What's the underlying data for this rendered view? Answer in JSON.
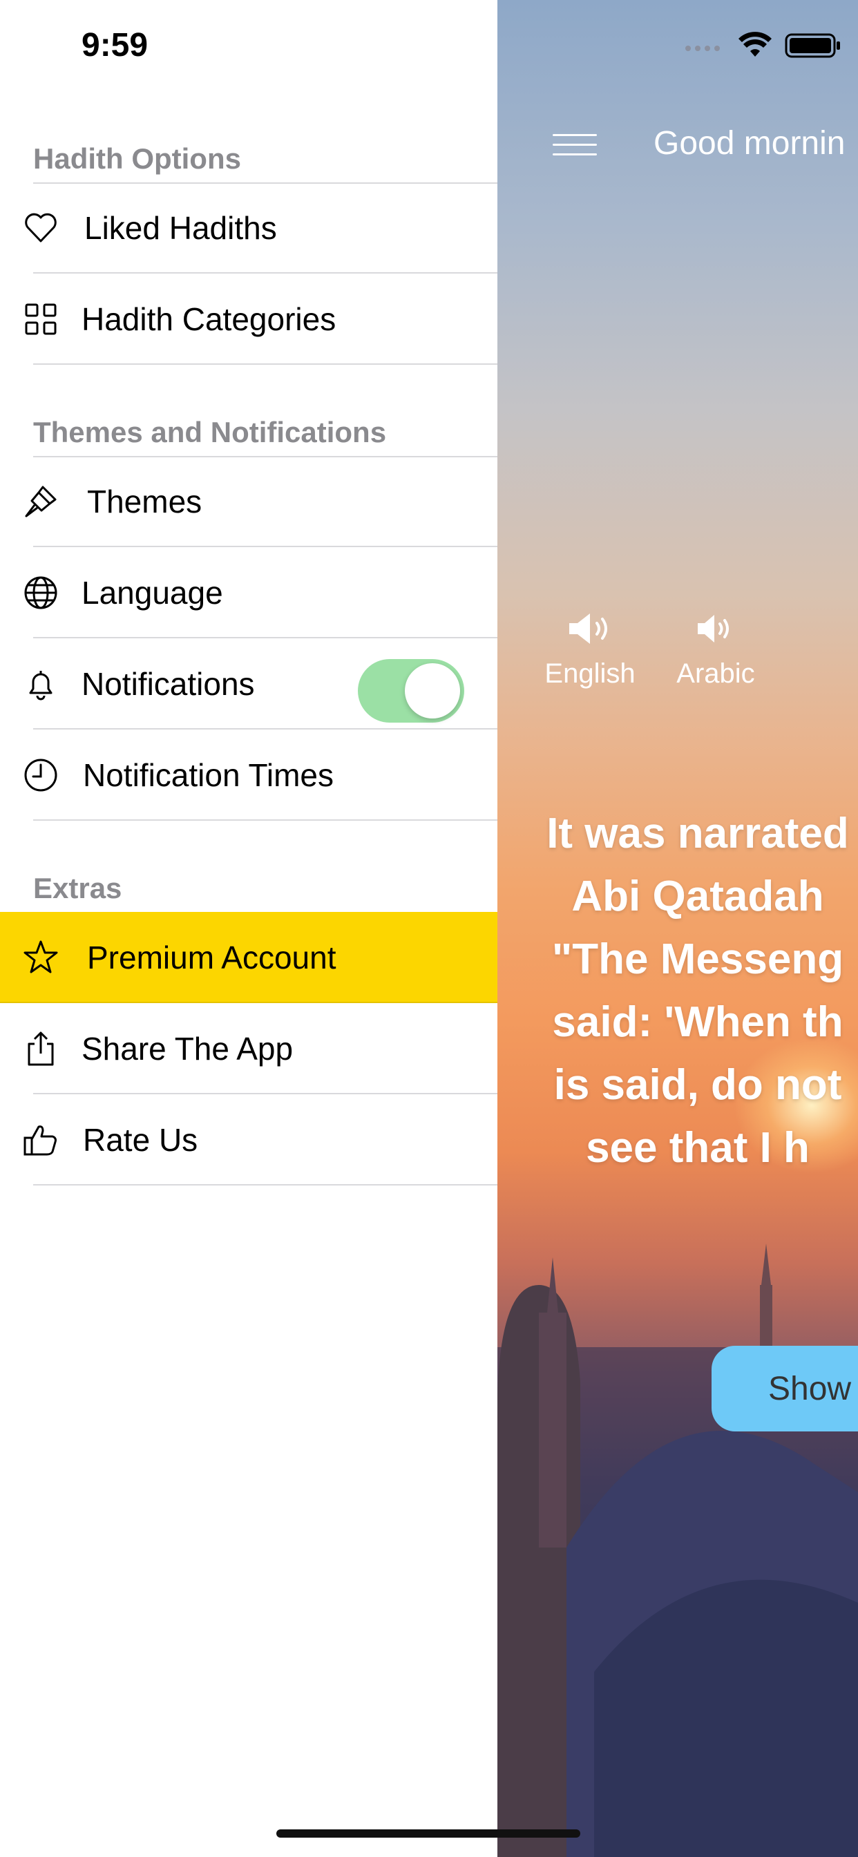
{
  "status_bar": {
    "time": "9:59"
  },
  "drawer": {
    "sections": [
      {
        "header": "Hadith Options",
        "items": [
          {
            "label": "Liked Hadiths",
            "icon": "heart-icon"
          },
          {
            "label": "Hadith Categories",
            "icon": "grid-icon"
          }
        ]
      },
      {
        "header": "Themes and Notifications",
        "items": [
          {
            "label": "Themes",
            "icon": "paintbrush-icon"
          },
          {
            "label": "Language",
            "icon": "globe-icon"
          },
          {
            "label": "Notifications",
            "icon": "bell-icon",
            "toggle_on": true
          },
          {
            "label": "Notification Times",
            "icon": "clock-icon"
          }
        ]
      },
      {
        "header": "Extras",
        "items": [
          {
            "label": "Premium Account",
            "icon": "star-icon",
            "highlight_color": "#FCD600"
          },
          {
            "label": "Share The App",
            "icon": "share-icon"
          },
          {
            "label": "Rate Us",
            "icon": "thumbs-up-icon"
          }
        ]
      }
    ]
  },
  "main": {
    "greeting": "Good mornin",
    "audio": {
      "english": "English",
      "arabic": "Arabic"
    },
    "hadith_text": "It was narrated\nAbi Qatadah\n\"The Messeng\nsaid: 'When th\nis said, do not\nsee that I h",
    "show_button": "Show",
    "show_button_color": "#6EC9F7"
  }
}
